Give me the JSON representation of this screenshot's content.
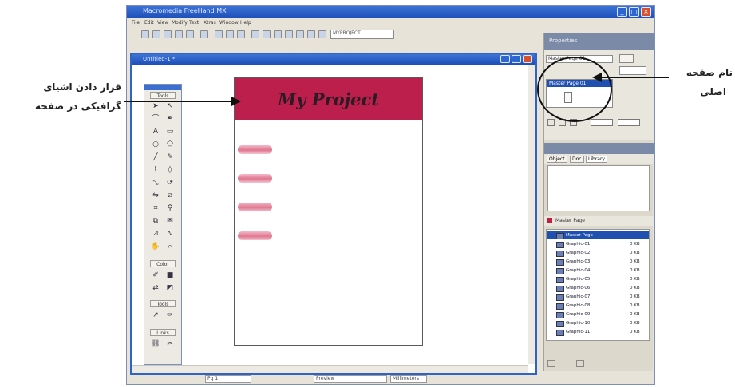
{
  "app": {
    "title": "Macromedia FreeHand MX",
    "menu": [
      "File",
      "Edit",
      "View",
      "Modify",
      "Text",
      "Xtras",
      "Window",
      "Help"
    ],
    "zoom_value": "MYPROJECT"
  },
  "document": {
    "title": "Untitled-1 *",
    "tools_label": "Tools",
    "tools_sections": [
      "Color",
      "Tools",
      "Links"
    ],
    "banner_text": "My Project",
    "pill_count": 4
  },
  "status": {
    "page_field": "Pg 1",
    "preview_field": "Preview",
    "units_field": "Millimeters"
  },
  "panels": {
    "pages_title": "Properties",
    "page_field": "Master Page 01",
    "page_selected": "Master Page 01",
    "object_tabs": [
      "Object",
      "Doc",
      "Library"
    ],
    "layers_title": "Master Page",
    "layers": [
      {
        "name": "Master Page",
        "size": "",
        "selected": true
      },
      {
        "name": "Graphic-01",
        "size": "0 KB"
      },
      {
        "name": "Graphic-02",
        "size": "0 KB"
      },
      {
        "name": "Graphic-03",
        "size": "0 KB"
      },
      {
        "name": "Graphic-04",
        "size": "0 KB"
      },
      {
        "name": "Graphic-05",
        "size": "0 KB"
      },
      {
        "name": "Graphic-06",
        "size": "0 KB"
      },
      {
        "name": "Graphic-07",
        "size": "0 KB"
      },
      {
        "name": "Graphic-08",
        "size": "0 KB"
      },
      {
        "name": "Graphic-09",
        "size": "0 KB"
      },
      {
        "name": "Graphic-10",
        "size": "0 KB"
      },
      {
        "name": "Graphic-11",
        "size": "0 KB"
      }
    ]
  },
  "annotations": {
    "left_line1": "قرار دادن اشیای",
    "left_line2": "گرافیکی در صفحه",
    "right_line1": "نام صفحه",
    "right_line2": "اصلی"
  },
  "colors": {
    "banner": "#bc1f4c",
    "titlebar": "#2458c4"
  }
}
